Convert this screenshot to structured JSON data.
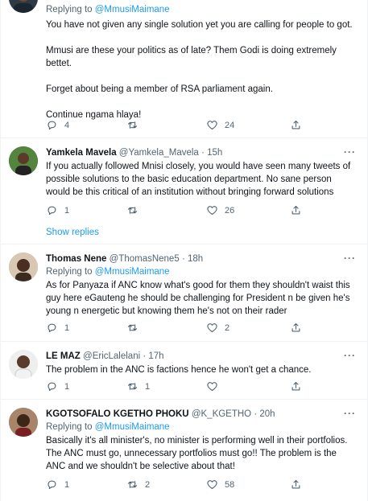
{
  "tweets": [
    {
      "replying_label": "Replying to",
      "replying_to": "@MmusiMaimane",
      "text": "You have not given any single solution yet you are calling for people to got.\n\nMmusi are these your politics as of late? Them Godi is doing extremely bettet.\n\nForget about being a member of RSA parliament again.\n\nContinue ngama hlaya!",
      "replies": "4",
      "retweets": "",
      "likes": "24"
    },
    {
      "name": "Yamkela Mavela",
      "handle": "@Yamkela_Mavela",
      "time": "15h",
      "text": "If you actually followed Mnisi closely, you would have seen many tweets of possible solutions to the basic education department. No sane person would be this critical of an institution without bringing forward solutions",
      "replies": "1",
      "retweets": "",
      "likes": "26",
      "show_replies": "Show replies"
    },
    {
      "name": "Thomas Nene",
      "handle": "@ThomasNene5",
      "time": "18h",
      "replying_label": "Replying to",
      "replying_to": "@MmusiMaimane",
      "text": "As for Panyaza if ANC know what's good for them they shouldn't waist this guy here eGauteng he should be challenging for President n be given he's young n energetic but knowing them he's not on their rader",
      "replies": "1",
      "retweets": "",
      "likes": "2"
    },
    {
      "name": "LE MAZ",
      "handle": "@EricLalelani",
      "time": "17h",
      "text": "The problem in the ANC is factions hence he won't get a chance.",
      "replies": "1",
      "retweets": "1",
      "likes": ""
    },
    {
      "name": "KGOTSOFALO KGETHO PHOKU",
      "handle": "@K_KGETHO",
      "time": "20h",
      "replying_label": "Replying to",
      "replying_to": "@MmusiMaimane",
      "text": "Basically it's all minister's, no minister is performing well in their portfolios. The ANC must go, unnecessary portfolios must go!! The problem is the ANC and we shouldn't be selective about that!",
      "replies": "1",
      "retweets": "2",
      "likes": "58"
    }
  ],
  "dot": "·",
  "more_label": "···",
  "icons": [
    "reply-icon",
    "retweet-icon",
    "like-icon",
    "share-icon"
  ],
  "colors": {
    "link": "#1d9bf0",
    "muted": "#536471",
    "border": "#eff3f4"
  }
}
